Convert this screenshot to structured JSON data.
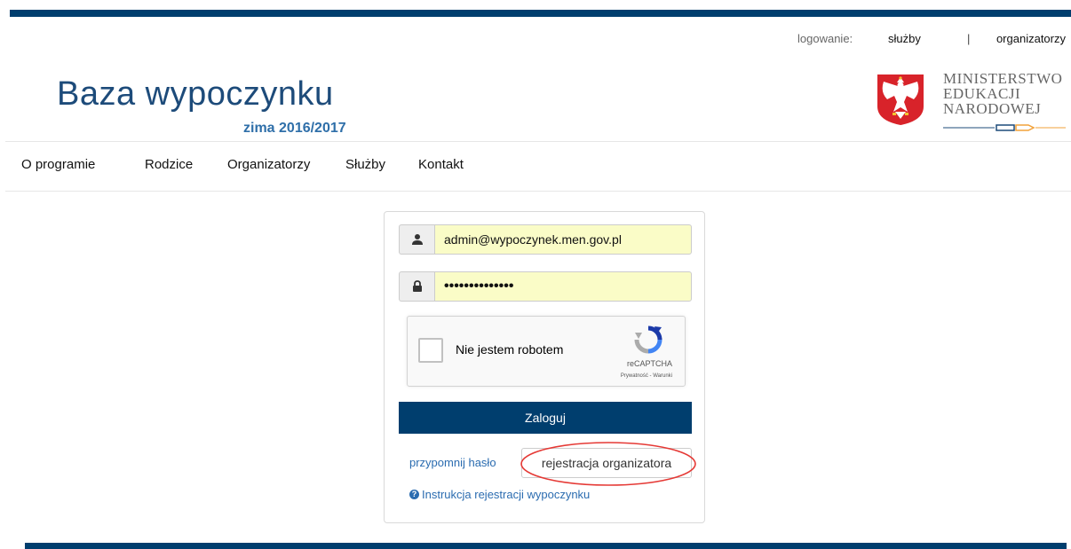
{
  "header": {
    "login_label": "logowanie:",
    "login_services": "służby",
    "login_separator": "|",
    "login_organizers": "organizatorzy",
    "title": "Baza wypoczynku",
    "season": "zima 2016/2017",
    "ministry_lines": [
      "MINISTERSTWO",
      "EDUKACJI",
      "NARODOWEJ"
    ]
  },
  "nav": {
    "items": [
      "O programie",
      "Rodzice",
      "Organizatorzy",
      "Służby",
      "Kontakt"
    ]
  },
  "login": {
    "email_value": "admin@wypoczynek.men.gov.pl",
    "password_value": "••••••••••••••",
    "user_icon": "user-icon",
    "lock_icon": "lock-icon",
    "submit_label": "Zaloguj",
    "remind_password": "przypomnij hasło",
    "register_organizer": "rejestracja organizatora",
    "help_link": "Instrukcja rejestracji wypoczynku"
  },
  "recaptcha": {
    "label": "Nie jestem robotem",
    "brand": "reCAPTCHA",
    "terms": "Prywatność - Warunki"
  },
  "colors": {
    "brand_dark": "#003e6e",
    "title_blue": "#1d4b7a",
    "link_blue": "#2b6cb0",
    "autofill_yellow": "#fafcc7",
    "highlight_red": "#e53935"
  }
}
